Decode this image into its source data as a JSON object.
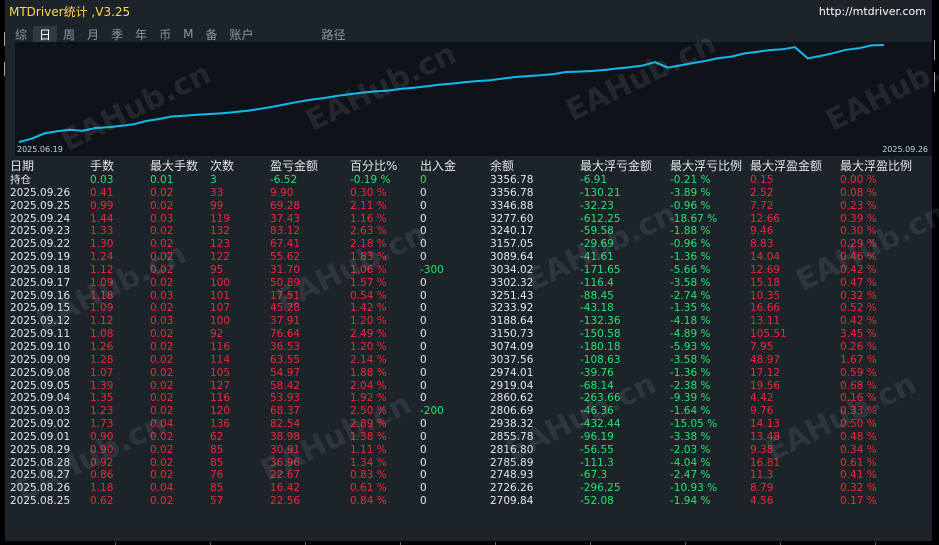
{
  "window": {
    "title": "MTDriver统计 ,V3.25",
    "url": "http://mtdriver.com"
  },
  "tabs": [
    {
      "label": "综",
      "active": false
    },
    {
      "label": "日",
      "active": true
    },
    {
      "label": "周",
      "active": false
    },
    {
      "label": "月",
      "active": false
    },
    {
      "label": "季",
      "active": false
    },
    {
      "label": "年",
      "active": false
    },
    {
      "label": "币",
      "active": false
    },
    {
      "label": "M",
      "active": false
    },
    {
      "label": "备",
      "active": false
    },
    {
      "label": "账户",
      "active": false
    },
    {
      "label": "路径",
      "active": false
    }
  ],
  "chart_data": {
    "type": "line",
    "x_start": "2025.06.19",
    "x_end": "2025.09.26",
    "y_min": 1000,
    "y_max": 3356.78,
    "values": [
      1000,
      1080,
      1210,
      1260,
      1300,
      1270,
      1340,
      1360,
      1390,
      1430,
      1510,
      1560,
      1620,
      1640,
      1660,
      1680,
      1700,
      1730,
      1760,
      1810,
      1860,
      1920,
      1980,
      2030,
      2070,
      2120,
      2160,
      2200,
      2230,
      2250,
      2290,
      2320,
      2350,
      2390,
      2420,
      2450,
      2480,
      2500,
      2540,
      2580,
      2600,
      2620,
      2650,
      2700,
      2709.84,
      2726.26,
      2748.93,
      2785.89,
      2816.8,
      2855.78,
      2938.32,
      2806.69,
      2860.62,
      2919.04,
      2974.01,
      3037.56,
      3074.09,
      3150.73,
      3188.64,
      3233.92,
      3251.43,
      3302.32,
      3034.02,
      3089.64,
      3157.05,
      3240.17,
      3277.6,
      3346.88,
      3356.78
    ],
    "color": "#12b8f0"
  },
  "table": {
    "headers": [
      "日期",
      "手数",
      "最大手数",
      "次数",
      "盈亏金额",
      "百分比%",
      "出入金",
      "余额",
      "最大浮亏金额",
      "最大浮亏比例",
      "最大浮盈金额",
      "最大浮盈比例"
    ],
    "hold": [
      "持仓",
      "0.03",
      "0.01",
      "3",
      "-6.52",
      "-0.19 %",
      "0",
      "3356.78",
      "-6.91",
      "-0.21 %",
      "0.15",
      "0.00 %"
    ],
    "rows": [
      [
        "2025.09.26",
        "0.41",
        "0.02",
        "33",
        "9.90",
        "0.30 %",
        "0",
        "3356.78",
        "-130.21",
        "-3.89 %",
        "2.52",
        "0.08 %"
      ],
      [
        "2025.09.25",
        "0.99",
        "0.02",
        "99",
        "69.28",
        "2.11 %",
        "0",
        "3346.88",
        "-32.23",
        "-0.96 %",
        "7.72",
        "0.23 %"
      ],
      [
        "2025.09.24",
        "1.44",
        "0.03",
        "119",
        "37.43",
        "1.16 %",
        "0",
        "3277.60",
        "-612.25",
        "-18.67 %",
        "12.66",
        "0.39 %"
      ],
      [
        "2025.09.23",
        "1.33",
        "0.02",
        "132",
        "83.12",
        "2.63 %",
        "0",
        "3240.17",
        "-59.58",
        "-1.88 %",
        "9.46",
        "0.30 %"
      ],
      [
        "2025.09.22",
        "1.30",
        "0.02",
        "123",
        "67.41",
        "2.18 %",
        "0",
        "3157.05",
        "-29.69",
        "-0.96 %",
        "8.83",
        "0.29 %"
      ],
      [
        "2025.09.19",
        "1.24",
        "0.02",
        "122",
        "55.62",
        "1.83 %",
        "0",
        "3089.64",
        "-41.61",
        "-1.36 %",
        "14.04",
        "0.46 %"
      ],
      [
        "2025.09.18",
        "1.12",
        "0.02",
        "95",
        "31.70",
        "1.06 %",
        "-300",
        "3034.02",
        "-171.65",
        "-5.66 %",
        "12.69",
        "0.42 %"
      ],
      [
        "2025.09.17",
        "1.09",
        "0.02",
        "100",
        "50.89",
        "1.57 %",
        "0",
        "3302.32",
        "-116.4",
        "-3.58 %",
        "15.18",
        "0.47 %"
      ],
      [
        "2025.09.16",
        "1.18",
        "0.03",
        "101",
        "17.51",
        "0.54 %",
        "0",
        "3251.43",
        "-88.45",
        "-2.74 %",
        "10.35",
        "0.32 %"
      ],
      [
        "2025.09.15",
        "1.09",
        "0.02",
        "107",
        "45.28",
        "1.42 %",
        "0",
        "3233.92",
        "-43.18",
        "-1.35 %",
        "16.66",
        "0.52 %"
      ],
      [
        "2025.09.12",
        "1.12",
        "0.03",
        "100",
        "37.91",
        "1.20 %",
        "0",
        "3188.64",
        "-132.36",
        "-4.18 %",
        "13.11",
        "0.42 %"
      ],
      [
        "2025.09.11",
        "1.08",
        "0.02",
        "92",
        "76.64",
        "2.49 %",
        "0",
        "3150.73",
        "-150.58",
        "-4.89 %",
        "105.51",
        "3.45 %"
      ],
      [
        "2025.09.10",
        "1.26",
        "0.02",
        "116",
        "36.53",
        "1.20 %",
        "0",
        "3074.09",
        "-180.18",
        "-5.93 %",
        "7.95",
        "0.26 %"
      ],
      [
        "2025.09.09",
        "1.28",
        "0.02",
        "114",
        "63.55",
        "2.14 %",
        "0",
        "3037.56",
        "-108.63",
        "-3.58 %",
        "48.97",
        "1.67 %"
      ],
      [
        "2025.09.08",
        "1.07",
        "0.02",
        "105",
        "54.97",
        "1.88 %",
        "0",
        "2974.01",
        "-39.76",
        "-1.36 %",
        "17.12",
        "0.59 %"
      ],
      [
        "2025.09.05",
        "1.39",
        "0.02",
        "127",
        "58.42",
        "2.04 %",
        "0",
        "2919.04",
        "-68.14",
        "-2.38 %",
        "19.56",
        "0.68 %"
      ],
      [
        "2025.09.04",
        "1.35",
        "0.02",
        "116",
        "53.93",
        "1.92 %",
        "0",
        "2860.62",
        "-263.66",
        "-9.39 %",
        "4.42",
        "0.16 %"
      ],
      [
        "2025.09.03",
        "1.23",
        "0.02",
        "120",
        "68.37",
        "2.50 %",
        "-200",
        "2806.69",
        "-46.36",
        "-1.64 %",
        "9.76",
        "0.33 %"
      ],
      [
        "2025.09.02",
        "1.73",
        "0.04",
        "136",
        "82.54",
        "2.89 %",
        "0",
        "2938.32",
        "-432.44",
        "-15.05 %",
        "14.13",
        "0.50 %"
      ],
      [
        "2025.09.01",
        "0.90",
        "0.02",
        "62",
        "38.98",
        "1.38 %",
        "0",
        "2855.78",
        "-96.19",
        "-3.38 %",
        "13.48",
        "0.48 %"
      ],
      [
        "2025.08.29",
        "0.90",
        "0.02",
        "85",
        "30.91",
        "1.11 %",
        "0",
        "2816.80",
        "-56.55",
        "-2.03 %",
        "9.38",
        "0.34 %"
      ],
      [
        "2025.08.28",
        "0.92",
        "0.02",
        "85",
        "36.96",
        "1.34 %",
        "0",
        "2785.89",
        "-111.3",
        "-4.04 %",
        "16.81",
        "0.61 %"
      ],
      [
        "2025.08.27",
        "0.86",
        "0.02",
        "76",
        "22.67",
        "0.83 %",
        "0",
        "2748.93",
        "-67.3",
        "-2.47 %",
        "11.3",
        "0.41 %"
      ],
      [
        "2025.08.26",
        "1.18",
        "0.04",
        "85",
        "16.42",
        "0.61 %",
        "0",
        "2726.26",
        "-296.25",
        "-10.93 %",
        "8.79",
        "0.32 %"
      ],
      [
        "2025.08.25",
        "0.62",
        "0.02",
        "57",
        "22.56",
        "0.84 %",
        "0",
        "2709.84",
        "-52.08",
        "-1.94 %",
        "4.56",
        "0.17 %"
      ]
    ]
  },
  "watermark": "EAHub.cn"
}
